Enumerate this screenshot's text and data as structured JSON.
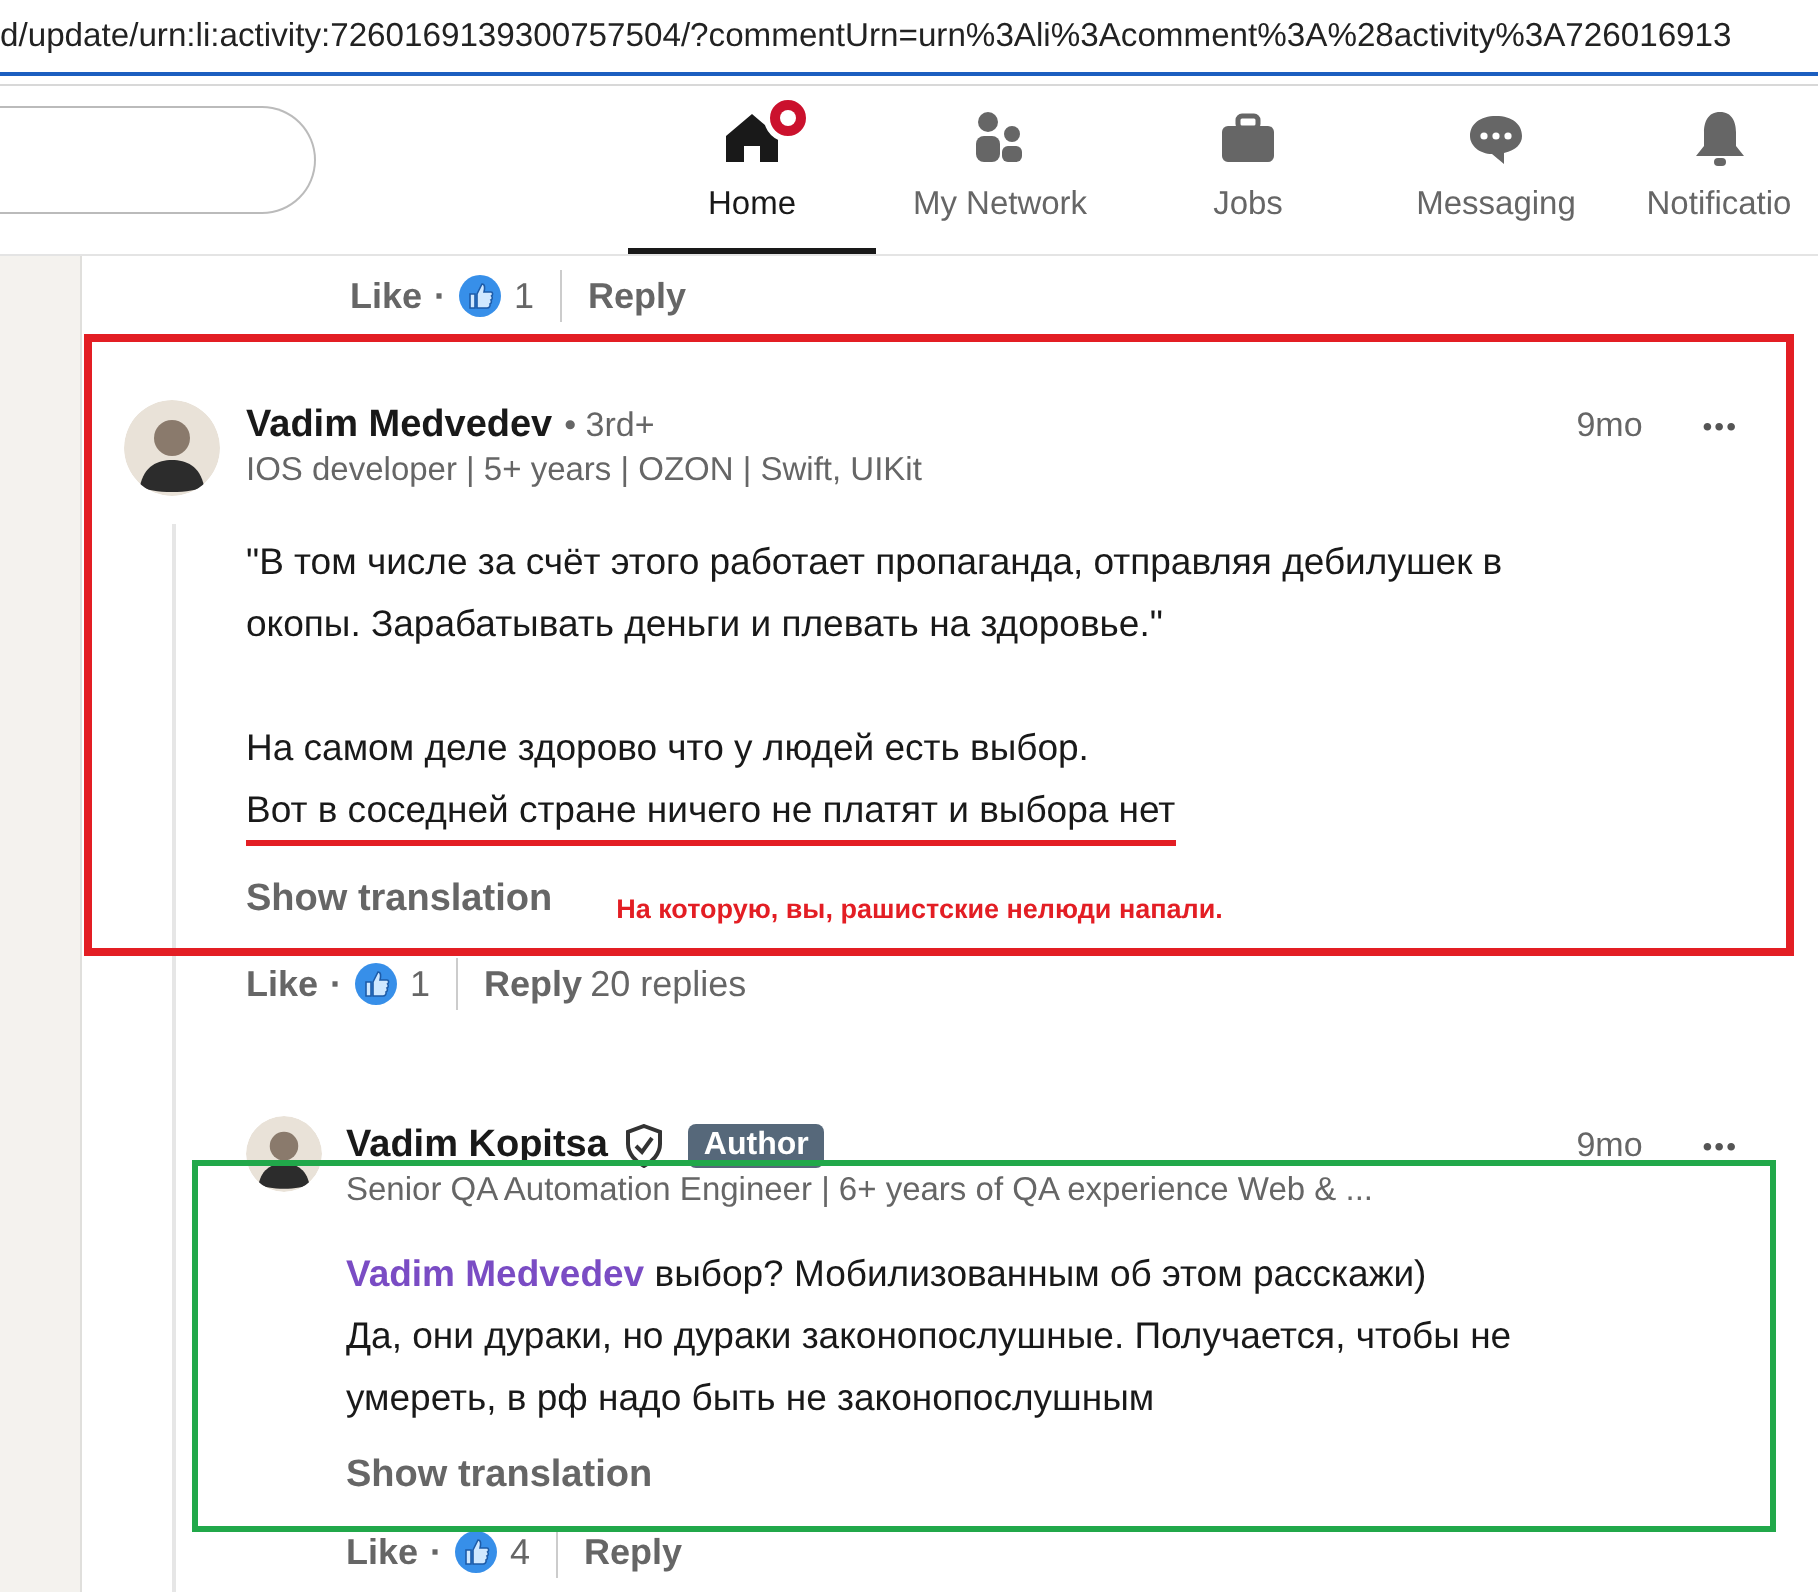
{
  "address_bar": {
    "url": "d/update/urn:li:activity:7260169139300757504/?commentUrn=urn%3Ali%3Acomment%3A%28activity%3A726016913"
  },
  "separator": "·",
  "nav": [
    {
      "label": "Home",
      "selected": true,
      "badge": true
    },
    {
      "label": "My Network",
      "selected": false,
      "badge": false
    },
    {
      "label": "Jobs",
      "selected": false,
      "badge": false
    },
    {
      "label": "Messaging",
      "selected": false,
      "badge": false
    },
    {
      "label": "Notificatio",
      "selected": false,
      "badge": false
    }
  ],
  "previous_actions": {
    "like": "Like",
    "reactions": "1",
    "reply": "Reply"
  },
  "comment": {
    "author": "Vadim Medvedev",
    "degree": "• 3rd+",
    "headline": "IOS developer | 5+ years | OZON | Swift, UIKit",
    "time": "9mo",
    "more": "•••",
    "paragraphs": [
      [
        {
          "text": "\"В том числе за счёт этого работает пропаганда, отправляя дебилушек в",
          "red_underline": false
        },
        {
          "text": "окопы. Зарабатывать деньги и плевать на здоровье.\"",
          "red_underline": false
        }
      ],
      [
        {
          "text": "На самом деле здорово что у людей есть выбор.",
          "red_underline": false
        },
        {
          "text": "Вот в соседней стране ничего не платят и выбора нет",
          "red_underline": true
        }
      ]
    ],
    "show_translation": "Show translation",
    "note": "На которую, вы, рашистские нелюди напали.",
    "actions": {
      "like": "Like",
      "reactions": "1",
      "reply": "Reply",
      "replies": "20 replies"
    }
  },
  "reply": {
    "author": "Vadim Kopitsa",
    "badge": "Author",
    "headline": "Senior QA Automation Engineer | 6+ years of QA experience Web & ...",
    "time": "9mo",
    "more": "•••",
    "lines": [
      {
        "mention": "Vadim Medvedev",
        "text": "выбор? Мобилизованным об этом расскажи)"
      },
      {
        "text": "Да, они дураки, но дураки законопослушные. Получается, чтобы не"
      },
      {
        "text": "умереть, в рф надо быть не законопослушным"
      }
    ],
    "show_translation": "Show translation",
    "actions": {
      "like": "Like",
      "reactions": "4",
      "reply": "Reply"
    }
  },
  "annotations": [
    {
      "kind": "box",
      "color": "#e31e24"
    },
    {
      "kind": "box",
      "color": "#21a84a"
    }
  ]
}
